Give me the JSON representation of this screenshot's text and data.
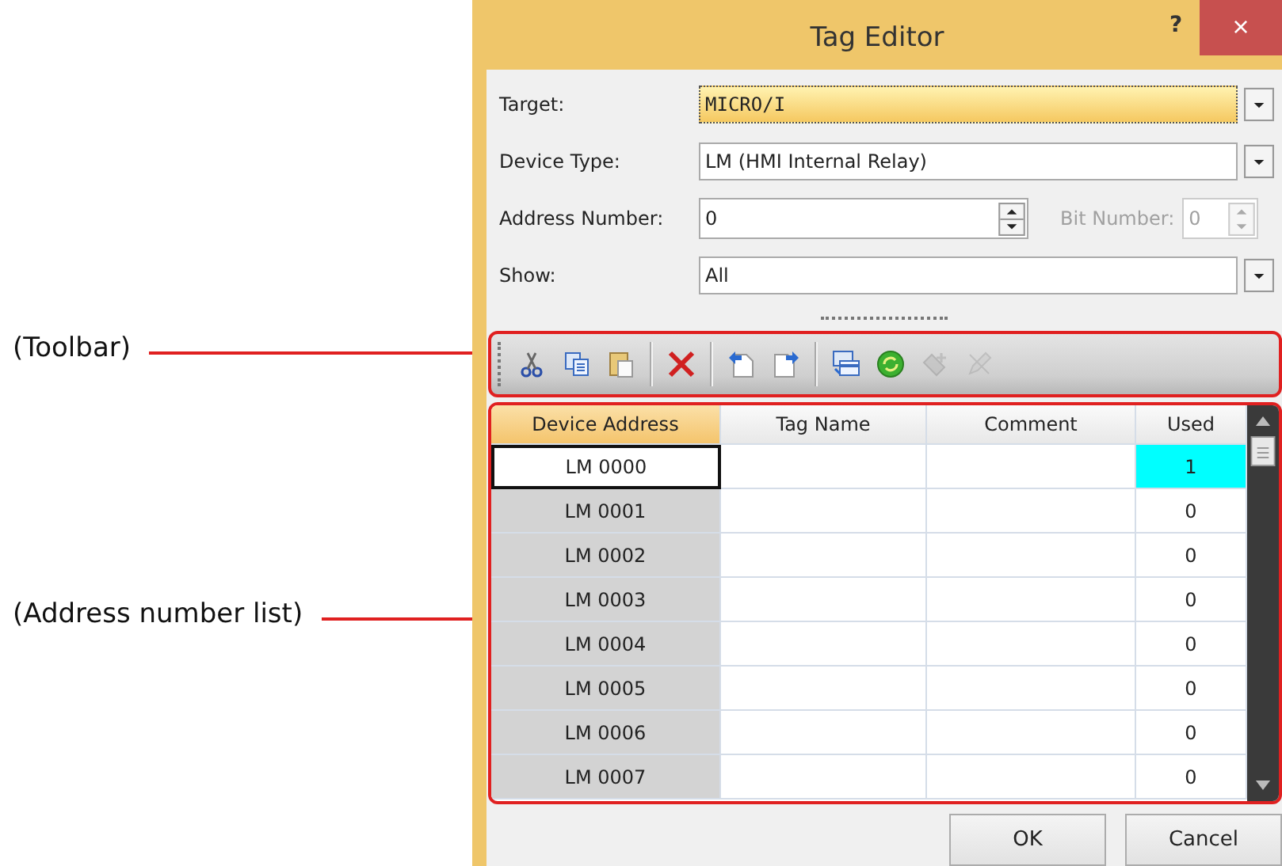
{
  "callouts": [
    {
      "label": "(Toolbar)"
    },
    {
      "label": "(Address number list)"
    }
  ],
  "window": {
    "title": "Tag Editor",
    "help": "?",
    "close": "×"
  },
  "fields": [
    {
      "label": "Target:",
      "kind": "combo",
      "value": "MICRO/I",
      "focused": true
    },
    {
      "label": "Device Type:",
      "kind": "combo",
      "value": "LM (HMI Internal Relay)",
      "focused": false
    },
    {
      "label": "Address Number:",
      "kind": "spin",
      "value": "0",
      "extra": {
        "label": "Bit Number:",
        "value": "0",
        "disabled": true
      }
    },
    {
      "label": "Show:",
      "kind": "combo",
      "value": "All",
      "focused": false
    }
  ],
  "toolbar": {
    "groups": [
      [
        {
          "kind": "cut",
          "disabled": false
        },
        {
          "kind": "copy",
          "disabled": false
        },
        {
          "kind": "paste",
          "disabled": false
        }
      ],
      [
        {
          "kind": "delete",
          "disabled": false
        }
      ],
      [
        {
          "kind": "import",
          "disabled": false
        },
        {
          "kind": "export",
          "disabled": false
        }
      ],
      [
        {
          "kind": "table",
          "disabled": false
        },
        {
          "kind": "refresh",
          "disabled": false
        },
        {
          "kind": "add",
          "disabled": true
        },
        {
          "kind": "edit",
          "disabled": true
        }
      ]
    ]
  },
  "grid": {
    "columns": [
      {
        "label": "Device Address",
        "selected": true
      },
      {
        "label": "Tag Name",
        "selected": false
      },
      {
        "label": "Comment",
        "selected": false
      },
      {
        "label": "Used",
        "selected": false
      }
    ],
    "rows": [
      {
        "address": "LM 0000",
        "used": "1",
        "selected": true,
        "highlighted": true
      },
      {
        "address": "LM 0001",
        "used": "0",
        "selected": false,
        "highlighted": false
      },
      {
        "address": "LM 0002",
        "used": "0",
        "selected": false,
        "highlighted": false
      },
      {
        "address": "LM 0003",
        "used": "0",
        "selected": false,
        "highlighted": false
      },
      {
        "address": "LM 0004",
        "used": "0",
        "selected": false,
        "highlighted": false
      },
      {
        "address": "LM 0005",
        "used": "0",
        "selected": false,
        "highlighted": false
      },
      {
        "address": "LM 0006",
        "used": "0",
        "selected": false,
        "highlighted": false
      },
      {
        "address": "LM 0007",
        "used": "0",
        "selected": false,
        "highlighted": false
      }
    ]
  },
  "buttons": [
    "OK",
    "Cancel"
  ]
}
